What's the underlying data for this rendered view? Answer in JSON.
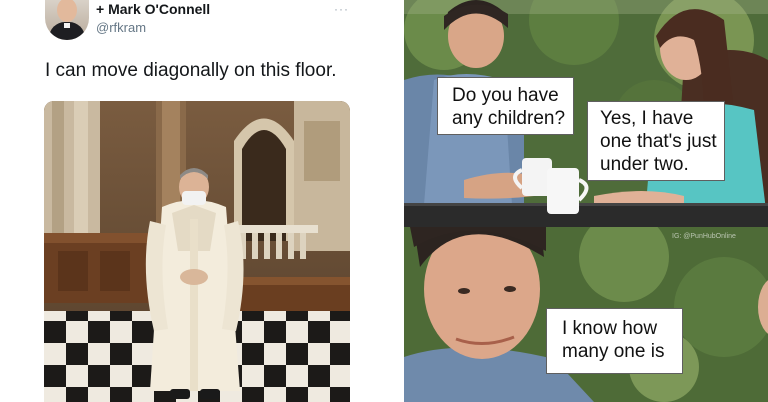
{
  "tweet": {
    "display_name": "+ Mark O'Connell",
    "handle": "@rfkram",
    "more_label": "···",
    "text": "I can move diagonally on this floor."
  },
  "meme": {
    "watermark": "IG: @PunHubOnline",
    "bubbles": [
      {
        "line1": "Do you have",
        "line2": "any children?"
      },
      {
        "line1": "Yes, I have",
        "line2": "one that's just",
        "line3": "under two."
      },
      {
        "line1": "I know how",
        "line2": "many one is"
      }
    ]
  },
  "colors": {
    "tweet_name": "#14171a",
    "tweet_handle": "#657786",
    "bubble_bg": "#ffffff",
    "foliage": "#3d5a2e"
  }
}
